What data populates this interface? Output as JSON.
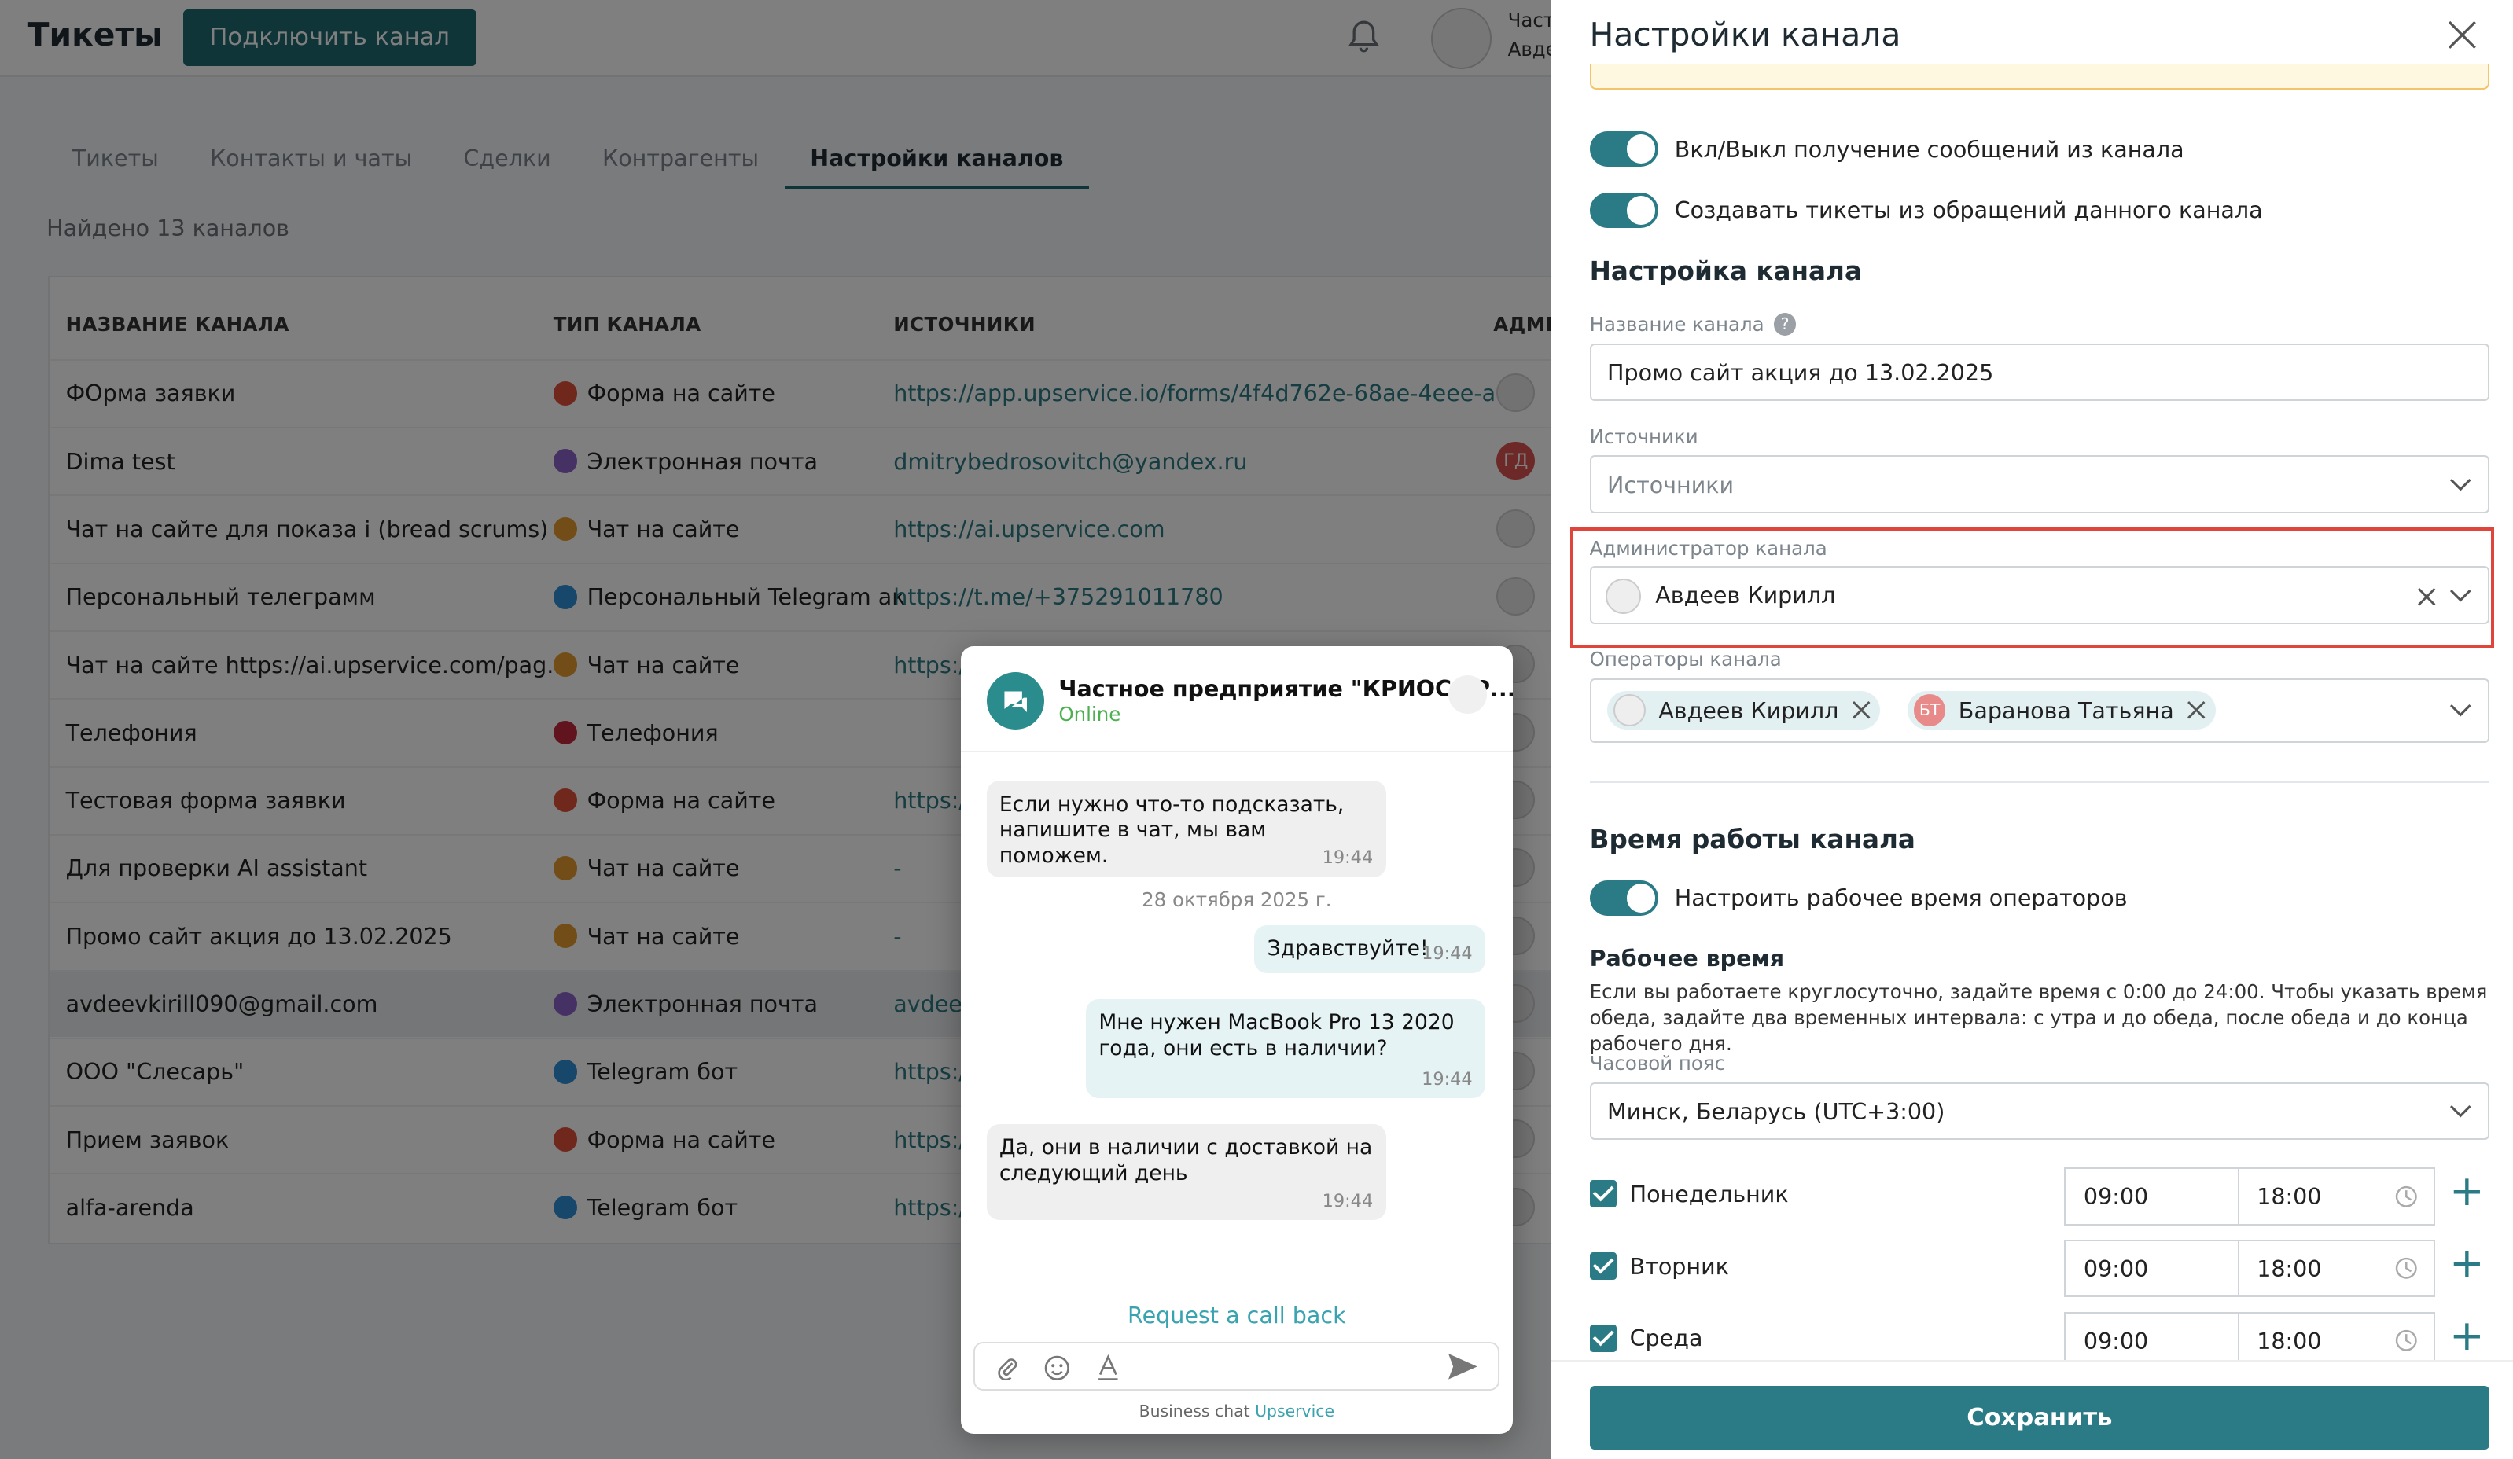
{
  "header": {
    "logo": "Тикеты",
    "connect_button": "Подключить канал",
    "user_line1": "Част",
    "user_line2": "Авде"
  },
  "tabs": [
    "Тикеты",
    "Контакты и чаты",
    "Сделки",
    "Контрагенты",
    "Настройки каналов"
  ],
  "active_tab": "Настройки каналов",
  "found_text": "Найдено 13 каналов",
  "table": {
    "columns": [
      "НАЗВАНИЕ КАНАЛА",
      "ТИП КАНАЛА",
      "ИСТОЧНИКИ",
      "АДМИ"
    ],
    "rows": [
      {
        "name": "ФОрма заявки",
        "type": "Форма на сайте",
        "icon": "form",
        "source": "https://app.upservice.io/forms/4f4d762e-68ae-4eee-a..."
      },
      {
        "name": "Dima test",
        "type": "Электронная почта",
        "icon": "mail",
        "source": "dmitrybedrosovitch@yandex.ru"
      },
      {
        "name": "Чат на сайте для показа i (bread scrums)",
        "type": "Чат на сайте",
        "icon": "chat",
        "source": "https://ai.upservice.com"
      },
      {
        "name": "Персональный телеграмм",
        "type": "Персональный Telegram ак",
        "icon": "tg",
        "source": "https://t.me/+375291011780"
      },
      {
        "name": "Чат на сайте https://ai.upservice.com/pag...",
        "type": "Чат на сайте",
        "icon": "chat",
        "source": "https:/"
      },
      {
        "name": "Телефония",
        "type": "Телефония",
        "icon": "phone",
        "source": ""
      },
      {
        "name": "Тестовая форма заявки",
        "type": "Форма на сайте",
        "icon": "form",
        "source": "https:/"
      },
      {
        "name": "Для проверки AI assistant",
        "type": "Чат на сайте",
        "icon": "chat",
        "source": "-"
      },
      {
        "name": "Промо сайт акция до 13.02.2025",
        "type": "Чат на сайте",
        "icon": "chat",
        "source": "-"
      },
      {
        "name": "avdeevkirill090@gmail.com",
        "type": "Электронная почта",
        "icon": "mail",
        "source": "avdeev"
      },
      {
        "name": "ООО \"Слесарь\"",
        "type": "Telegram бот",
        "icon": "tg",
        "source": "https:/"
      },
      {
        "name": "Прием заявок",
        "type": "Форма на сайте",
        "icon": "form",
        "source": "https:/"
      },
      {
        "name": "alfa-arenda",
        "type": "Telegram бот",
        "icon": "tg",
        "source": "https:/"
      }
    ],
    "admin_initials_row2": "ГД"
  },
  "widget": {
    "title": "Частное предприятие \"КРИОС ГР...",
    "status": "Online",
    "msg1": "Если нужно что-то подсказать, напишите в чат, мы вам поможем.",
    "msg1_time": "19:44",
    "date": "28 октября 2025 г.",
    "msg2": "Здравствуйте!",
    "msg2_time": "19:44",
    "msg3": "Мне нужен MacBook Pro 13 2020 года, они есть в наличии?",
    "msg3_time": "19:44",
    "msg4": "Да, они в наличии с доставкой на следующий день",
    "msg4_time": "19:44",
    "call_back": "Request a call back",
    "footer_prefix": "Business chat",
    "footer_brand": "Upservice"
  },
  "drawer": {
    "title": "Настройки канала",
    "toggle1": "Вкл/Выкл получение сообщений из канала",
    "toggle2": "Создавать тикеты из обращений данного канала",
    "section_settings": "Настройка канала",
    "name_label": "Название канала",
    "name_value": "Промо сайт акция до 13.02.2025",
    "sources_label": "Источники",
    "sources_placeholder": "Источники",
    "admin_label": "Администратор канала",
    "admin_value": "Авдеев Кирилл",
    "operators_label": "Операторы канала",
    "operators": [
      {
        "name": "Авдеев Кирилл",
        "initials": ""
      },
      {
        "name": "Баранова Татьяна",
        "initials": "БТ"
      }
    ],
    "section_hours": "Время работы канала",
    "toggle3": "Настроить рабочее время операторов",
    "work_time_title": "Рабочее время",
    "work_time_note": "Если вы работаете круглосуточно, задайте время с 0:00 до 24:00. Чтобы указать время обеда, задайте два временных интервала: с утра и до обеда, после обеда и до конца рабочего дня.",
    "tz_label": "Часовой пояс",
    "tz_value": "Минск, Беларусь (UTC+3:00)",
    "days": [
      {
        "name": "Понедельник",
        "from": "09:00",
        "to": "18:00"
      },
      {
        "name": "Вторник",
        "from": "09:00",
        "to": "18:00"
      },
      {
        "name": "Среда",
        "from": "09:00",
        "to": "18:00"
      }
    ],
    "save_button": "Сохранить"
  }
}
